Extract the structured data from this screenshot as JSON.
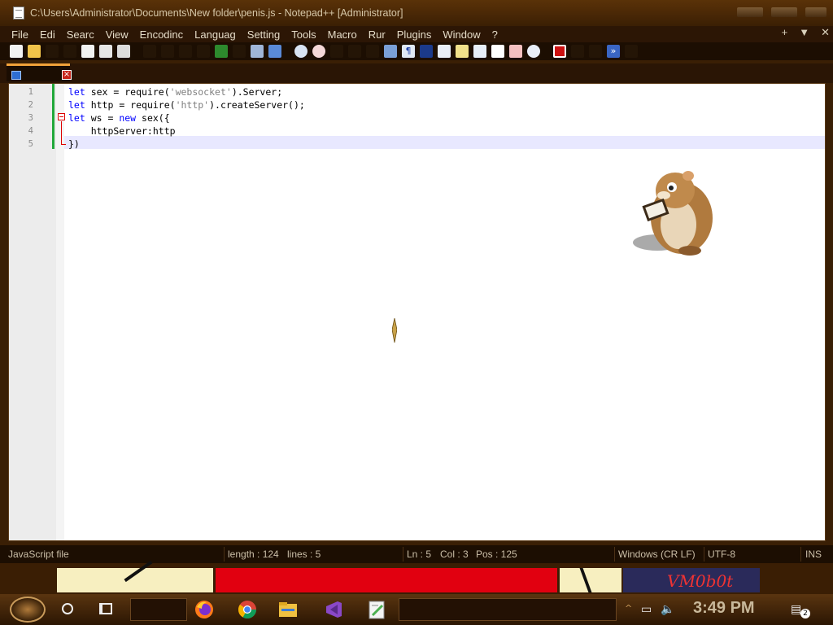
{
  "window": {
    "title": "C:\\Users\\Administrator\\Documents\\New folder\\penis.js - Notepad++ [Administrator]"
  },
  "menu": {
    "items": [
      "File",
      "Edi",
      "Searc",
      "View",
      "Encodinc",
      "Languag",
      "Setting",
      "Tools",
      "Macro",
      "Rur",
      "Plugins",
      "Window",
      "?"
    ],
    "right": [
      "+",
      "▼",
      "✕"
    ]
  },
  "editor": {
    "lines": [
      {
        "num": "1",
        "tokens": [
          {
            "t": "let",
            "c": "kw"
          },
          {
            "t": " sex = require(",
            "c": ""
          },
          {
            "t": "'websocket'",
            "c": "str"
          },
          {
            "t": ").Server;",
            "c": ""
          }
        ]
      },
      {
        "num": "2",
        "tokens": [
          {
            "t": "let",
            "c": "kw"
          },
          {
            "t": " http = require(",
            "c": ""
          },
          {
            "t": "'http'",
            "c": "str"
          },
          {
            "t": ").createServer();",
            "c": ""
          }
        ]
      },
      {
        "num": "3",
        "tokens": [
          {
            "t": "let",
            "c": "kw"
          },
          {
            "t": " ws = ",
            "c": ""
          },
          {
            "t": "new",
            "c": "kw"
          },
          {
            "t": " sex({",
            "c": ""
          }
        ]
      },
      {
        "num": "4",
        "tokens": [
          {
            "t": "    httpServer:http",
            "c": ""
          }
        ]
      },
      {
        "num": "5",
        "tokens": [
          {
            "t": "})",
            "c": ""
          }
        ]
      }
    ]
  },
  "status": {
    "filetype": "JavaScript file",
    "length": "length : 124",
    "lines": "lines : 5",
    "ln": "Ln : 5",
    "col": "Col : 3",
    "pos": "Pos : 125",
    "eol": "Windows (CR LF)",
    "encoding": "UTF-8",
    "mode": "INS"
  },
  "desktop": {
    "watermark": "VM0b0t"
  },
  "taskbar": {
    "clock": "3:49 PM",
    "notifications": "2"
  },
  "colors": {
    "keyword": "#0000ff",
    "string": "#808080",
    "accent": "#f2a23a"
  }
}
